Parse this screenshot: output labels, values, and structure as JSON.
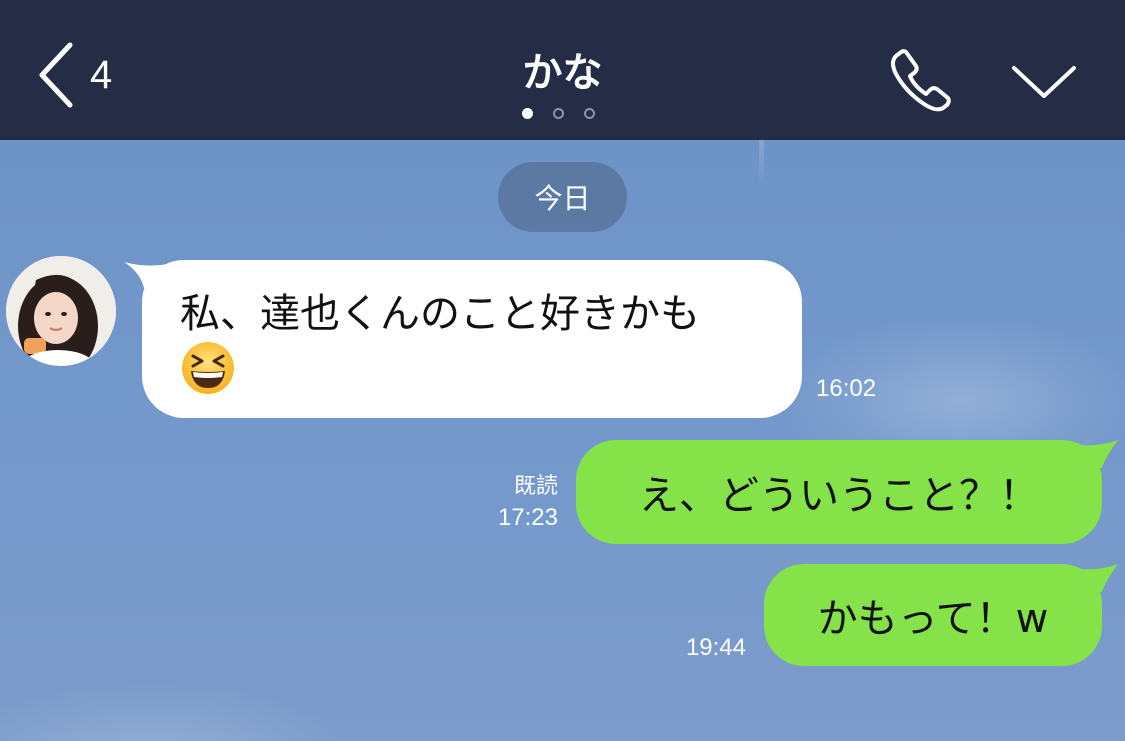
{
  "header": {
    "back_count": "4",
    "title": "かな",
    "page_dots": 3,
    "active_dot": 0
  },
  "chat": {
    "date_label": "今日",
    "messages": [
      {
        "direction": "incoming",
        "text": "私、達也くんのこと好きかも",
        "emoji": "grinning-squinting-face",
        "time": "16:02"
      },
      {
        "direction": "outgoing",
        "text": "え、どういうこと？！",
        "read_label": "既読",
        "time": "17:23"
      },
      {
        "direction": "outgoing",
        "text": "かもって！w",
        "time": "19:44"
      }
    ]
  },
  "colors": {
    "header_bg": "#242d45",
    "chat_bg": "#7194c6",
    "incoming_bubble": "#ffffff",
    "outgoing_bubble": "#85e249"
  },
  "icons": {
    "back": "chevron-left-icon",
    "call": "phone-icon",
    "menu": "chevron-down-icon"
  }
}
